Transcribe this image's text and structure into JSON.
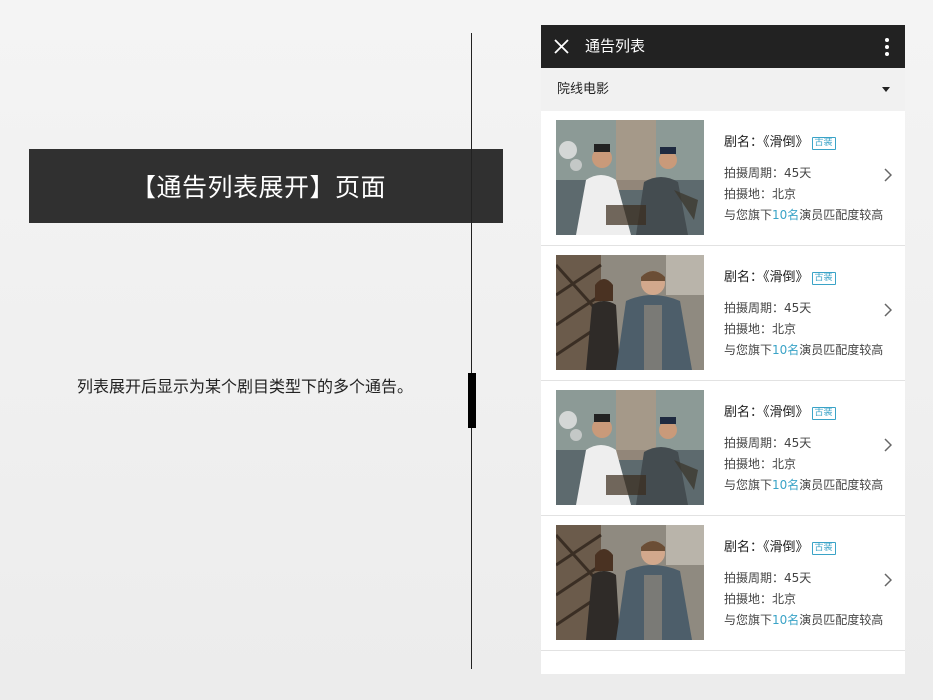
{
  "annotation": {
    "title": "【通告列表展开】页面",
    "description": "列表展开后显示为某个剧目类型下的多个通告。"
  },
  "phone": {
    "header_title": "通告列表",
    "category": "院线电影",
    "items": [
      {
        "name_prefix": "剧名：",
        "title": "《滑倒》",
        "tag": "古装",
        "period": "拍摄周期：45天",
        "location": "拍摄地：北京",
        "match_prefix": "与您旗下",
        "match_count": "10名",
        "match_suffix": "演员匹配度较高",
        "thumb_type": "costume"
      },
      {
        "name_prefix": "剧名：",
        "title": "《滑倒》",
        "tag": "古装",
        "period": "拍摄周期：45天",
        "location": "拍摄地：北京",
        "match_prefix": "与您旗下",
        "match_count": "10名",
        "match_suffix": "演员匹配度较高",
        "thumb_type": "modern"
      },
      {
        "name_prefix": "剧名：",
        "title": "《滑倒》",
        "tag": "古装",
        "period": "拍摄周期：45天",
        "location": "拍摄地：北京",
        "match_prefix": "与您旗下",
        "match_count": "10名",
        "match_suffix": "演员匹配度较高",
        "thumb_type": "costume"
      },
      {
        "name_prefix": "剧名：",
        "title": "《滑倒》",
        "tag": "古装",
        "period": "拍摄周期：45天",
        "location": "拍摄地：北京",
        "match_prefix": "与您旗下",
        "match_count": "10名",
        "match_suffix": "演员匹配度较高",
        "thumb_type": "modern"
      }
    ]
  },
  "colors": {
    "header_bg": "#222222",
    "accent": "#3aa3c7",
    "banner_bg": "#303030"
  }
}
